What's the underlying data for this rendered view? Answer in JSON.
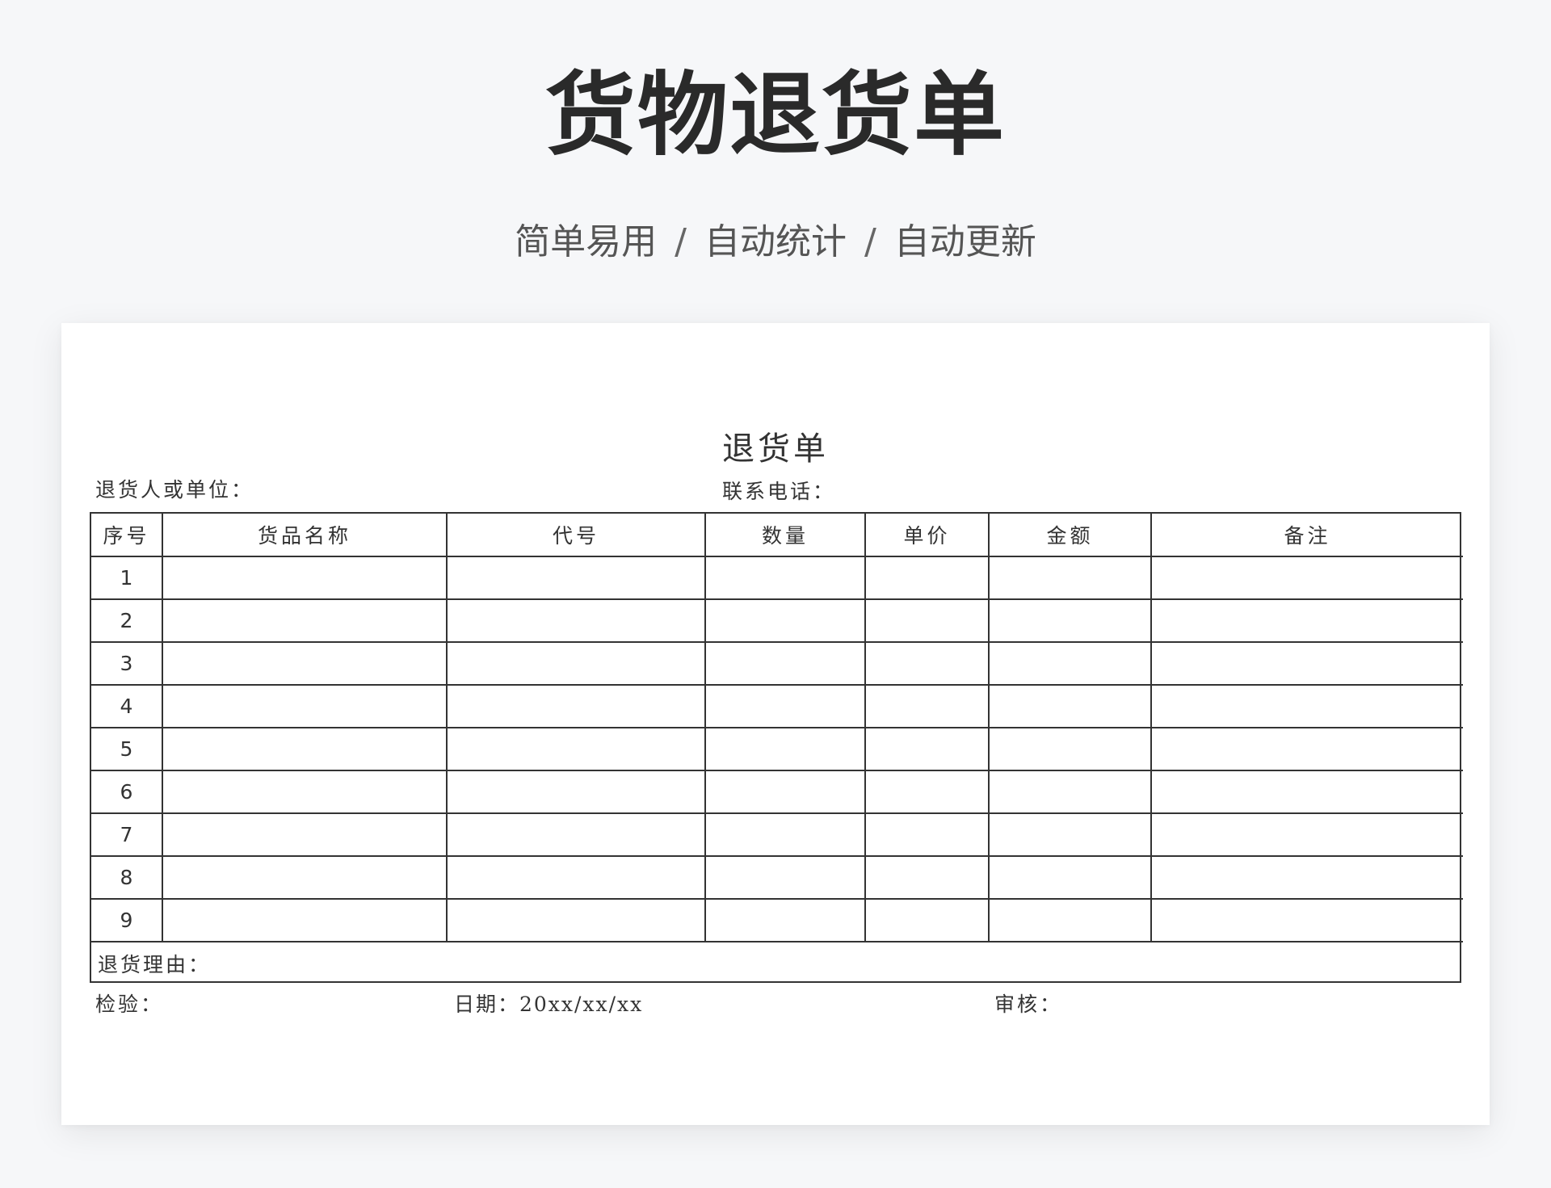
{
  "hero": {
    "title": "货物退货单",
    "subtitle_1": "简单易用",
    "subtitle_sep": "/",
    "subtitle_2": "自动统计",
    "subtitle_3": "自动更新"
  },
  "form": {
    "title": "退货单",
    "returner_label": "退货人或单位：",
    "phone_label": "联系电话：",
    "table": {
      "headers": [
        "序号",
        "货品名称",
        "代号",
        "数量",
        "单价",
        "金额",
        "备注"
      ],
      "row_numbers": [
        "1",
        "2",
        "3",
        "4",
        "5",
        "6",
        "7",
        "8",
        "9"
      ]
    },
    "reason_label": "退货理由：",
    "inspection_label": "检验：",
    "date_label": "日期：20xx/xx/xx",
    "review_label": "审核："
  }
}
